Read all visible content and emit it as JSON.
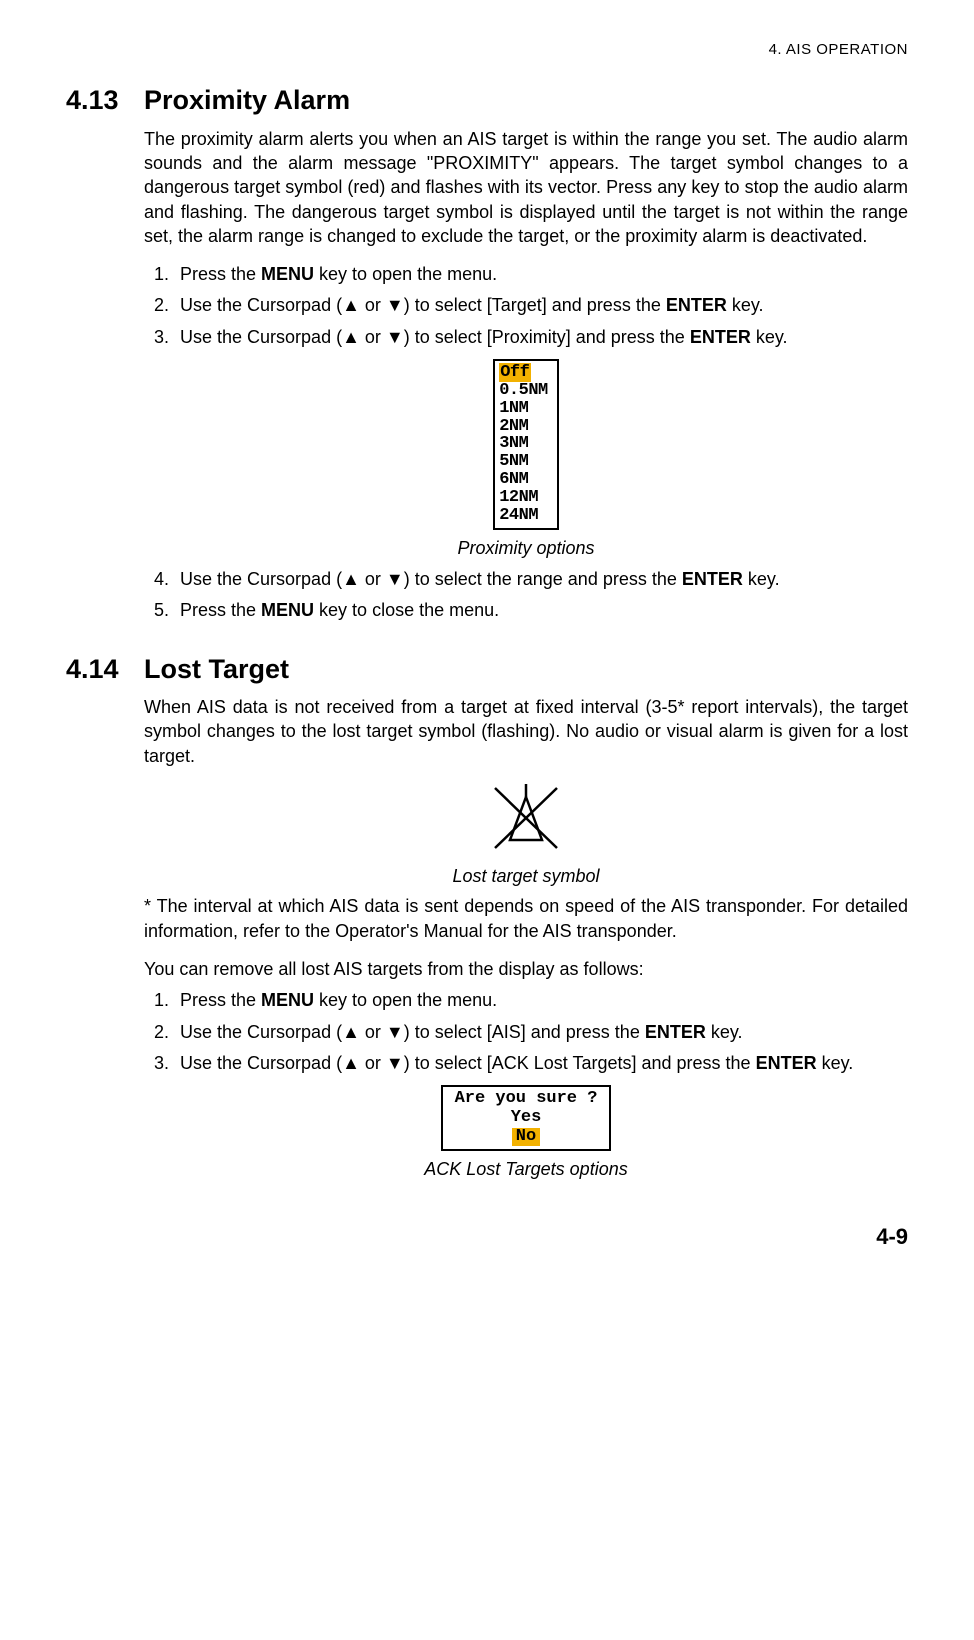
{
  "header": {
    "chapter": "4.  AIS OPERATION"
  },
  "sec413": {
    "num": "4.13",
    "title": "Proximity Alarm",
    "para": "The proximity alarm alerts you when an AIS target is within the range you set. The audio alarm sounds and the alarm message \"PROXIMITY\" appears. The target symbol changes to a dangerous target symbol (red) and flashes with its vector. Press any key to stop the audio alarm and flashing. The dangerous target symbol is displayed until the target is not within the range set, the alarm range is changed to exclude the target, or the proximity alarm is deactivated.",
    "step1_a": "Press the ",
    "step1_menu": "MENU",
    "step1_b": " key to open the menu.",
    "step2_a": "Use the Cursorpad (▲ or ▼) to select [Target] and press the ",
    "step2_enter": "ENTER",
    "step2_b": " key.",
    "step3_a": "Use the Cursorpad (▲ or ▼) to select [Proximity] and press the ",
    "step3_enter": "ENTER",
    "step3_b": " key.",
    "options": {
      "o0": "Off",
      "o1": "0.5NM",
      "o2": "1NM",
      "o3": "2NM",
      "o4": "3NM",
      "o5": "5NM",
      "o6": "6NM",
      "o7": "12NM",
      "o8": "24NM"
    },
    "caption": "Proximity options",
    "step4_a": "Use the Cursorpad (▲ or ▼) to select the range and press the ",
    "step4_enter": "ENTER",
    "step4_b": " key.",
    "step5_a": "Press the ",
    "step5_menu": "MENU",
    "step5_b": " key to close the menu."
  },
  "sec414": {
    "num": "4.14",
    "title": "Lost Target",
    "para1": "When AIS data is not received from a target at fixed interval (3-5* report intervals), the target symbol changes to the lost target symbol (flashing). No audio or visual alarm is given for a lost target.",
    "symbol_caption": "Lost target symbol",
    "para2": "* The interval at which AIS data is sent depends on speed of the AIS transponder. For detailed information, refer to the Operator's Manual for the AIS transponder.",
    "para3": "You can remove all lost AIS targets from the display as follows:",
    "step1_a": "Press the ",
    "step1_menu": "MENU",
    "step1_b": " key to open the menu.",
    "step2_a": "Use the Cursorpad (▲ or ▼) to select [AIS] and press the ",
    "step2_enter": "ENTER",
    "step2_b": " key.",
    "step3_a": "Use the Cursorpad (▲ or ▼) to select [ACK Lost Targets] and press the ",
    "step3_enter": "ENTER",
    "step3_b": " key.",
    "ack": {
      "prompt": "Are you sure ?",
      "yes": "Yes",
      "no": "No"
    },
    "ack_caption": "ACK Lost Targets options"
  },
  "page_num": "4-9"
}
